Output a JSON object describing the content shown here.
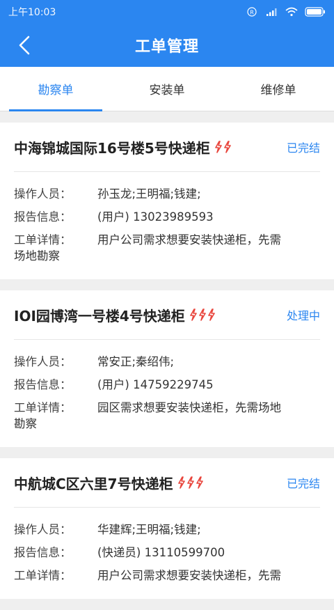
{
  "statusbar": {
    "time": "上午10:03"
  },
  "header": {
    "title": "工单管理"
  },
  "tabs": [
    {
      "label": "勘察单"
    },
    {
      "label": "安装单"
    },
    {
      "label": "维修单"
    }
  ],
  "labels": {
    "operator": "操作人员：",
    "report": "报告信息：",
    "detail": "工单详情："
  },
  "orders": [
    {
      "title": "中海锦城国际16号楼5号快递柜",
      "urgency": 2,
      "status": "已完结",
      "operators": "孙玉龙;王明福;钱建;",
      "report": "(用户)  13023989593",
      "detail_line1": "用户公司需求想要安装快递柜，先需",
      "detail_line2": "场地勘察"
    },
    {
      "title": "IOI园博湾一号楼4号快递柜",
      "urgency": 3,
      "status": "处理中",
      "operators": "常安正;秦绍伟;",
      "report": "(用户)  14759229745",
      "detail_line1": "园区需求想要安装快递柜，先需场地",
      "detail_line2": "勘察"
    },
    {
      "title": "中航城C区六里7号快递柜",
      "urgency": 3,
      "status": "已完结",
      "operators": "华建辉;王明福;钱建;",
      "report": "(快递员)  13110599700",
      "detail_line1": "用户公司需求想要安装快递柜，先需",
      "detail_line2": ""
    }
  ],
  "colors": {
    "primary": "#2b86f0",
    "urgency": "#e8453c"
  }
}
